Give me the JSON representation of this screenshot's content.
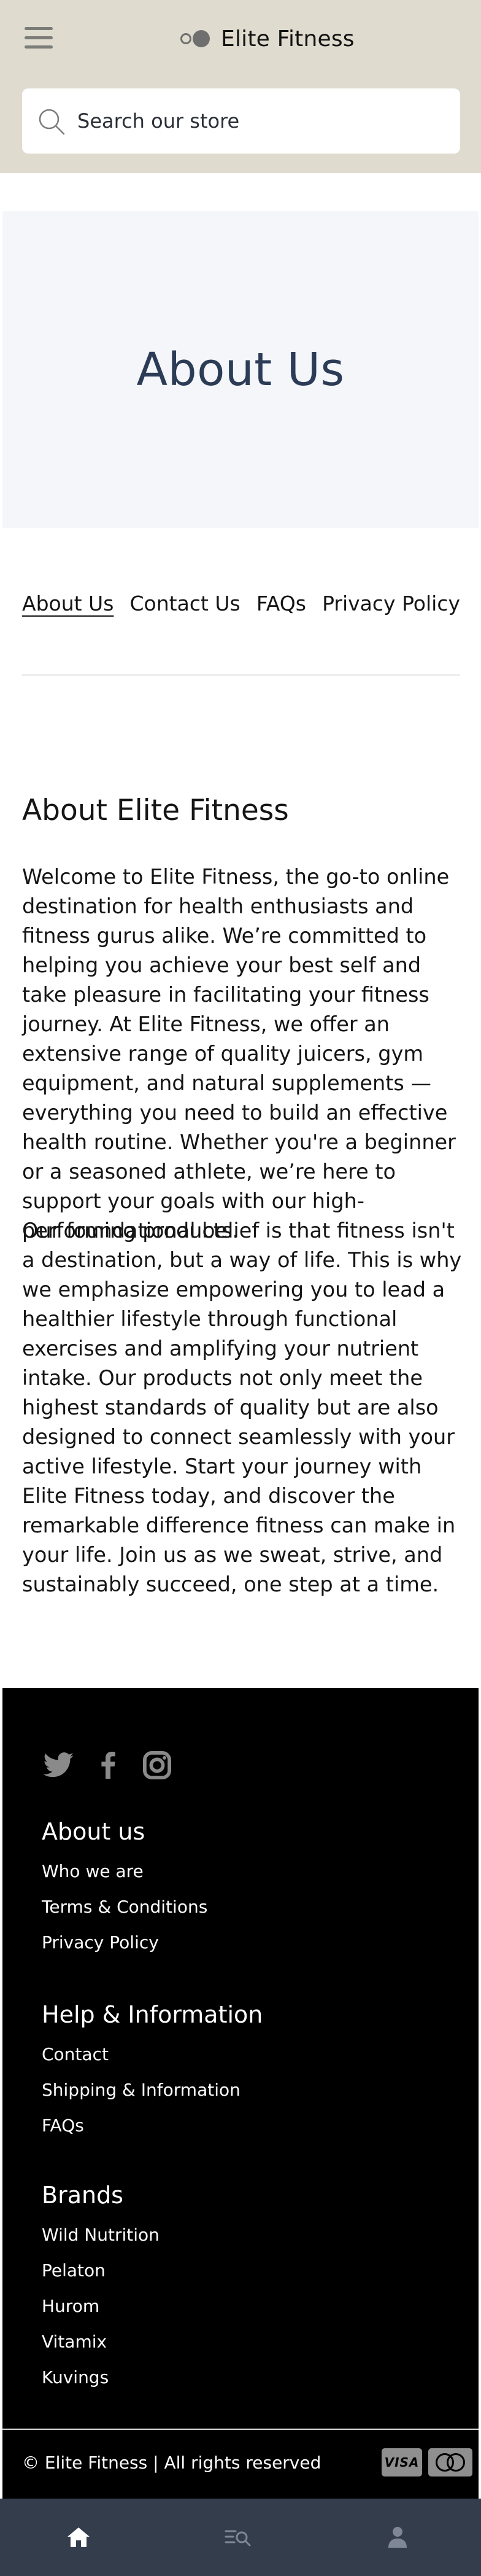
{
  "header": {
    "brand_name": "Elite Fitness",
    "menu_icon": "hamburger-menu-icon",
    "logo_icon": "brand-logo-icon",
    "background": "#dfdbcf"
  },
  "search": {
    "placeholder": "Search our store",
    "value": "",
    "icon": "search-icon"
  },
  "hero": {
    "title": "About Us"
  },
  "subnav": {
    "items": [
      {
        "label": "About Us",
        "active": true
      },
      {
        "label": "Contact Us",
        "active": false
      },
      {
        "label": "FAQs",
        "active": false
      },
      {
        "label": "Privacy Policy",
        "active": false
      }
    ]
  },
  "content": {
    "title": "About Elite Fitness",
    "paragraphs": [
      "Welcome to Elite Fitness, the go-to online destination for health enthusiasts and fitness gurus alike. We’re committed to helping you achieve your best self and take pleasure in facilitating your fitness journey. At Elite Fitness, we offer an extensive range of quality juicers, gym equipment, and natural supplements — everything you need to build an effective health routine. Whether you're a beginner or a seasoned athlete, we’re here to support your goals with our high-performing products.",
      "Our foundational belief is that fitness isn't a destination, but a way of life. This is why we emphasize empowering you to lead a healthier lifestyle through functional exercises and amplifying your nutrient intake. Our products not only meet the highest standards of quality but are also designed to connect seamlessly with your active lifestyle. Start your journey with Elite Fitness today, and discover the remarkable difference fitness can make in your life. Join us as we sweat, strive, and sustainably succeed, one step at a time."
    ]
  },
  "footer": {
    "social_icons": [
      "twitter-icon",
      "facebook-icon",
      "instagram-icon"
    ],
    "sections": [
      {
        "title": "About us",
        "links": [
          "Who we are",
          "Terms & Conditions",
          "Privacy Policy"
        ]
      },
      {
        "title": "Help & Information",
        "links": [
          "Contact",
          "Shipping & Information",
          "FAQs"
        ]
      },
      {
        "title": "Brands",
        "links": [
          "Wild Nutrition",
          "Pelaton",
          "Hurom",
          "Vitamix",
          "Kuvings"
        ]
      }
    ],
    "copyright": "© Elite Fitness | All rights reserved",
    "payment_icons": [
      "visa-card-icon",
      "mastercard-icon"
    ],
    "visa_text": "VISA"
  },
  "bottom_nav": {
    "items": [
      "home-icon",
      "search-list-icon",
      "account-icon"
    ],
    "background": "#343d4c"
  }
}
